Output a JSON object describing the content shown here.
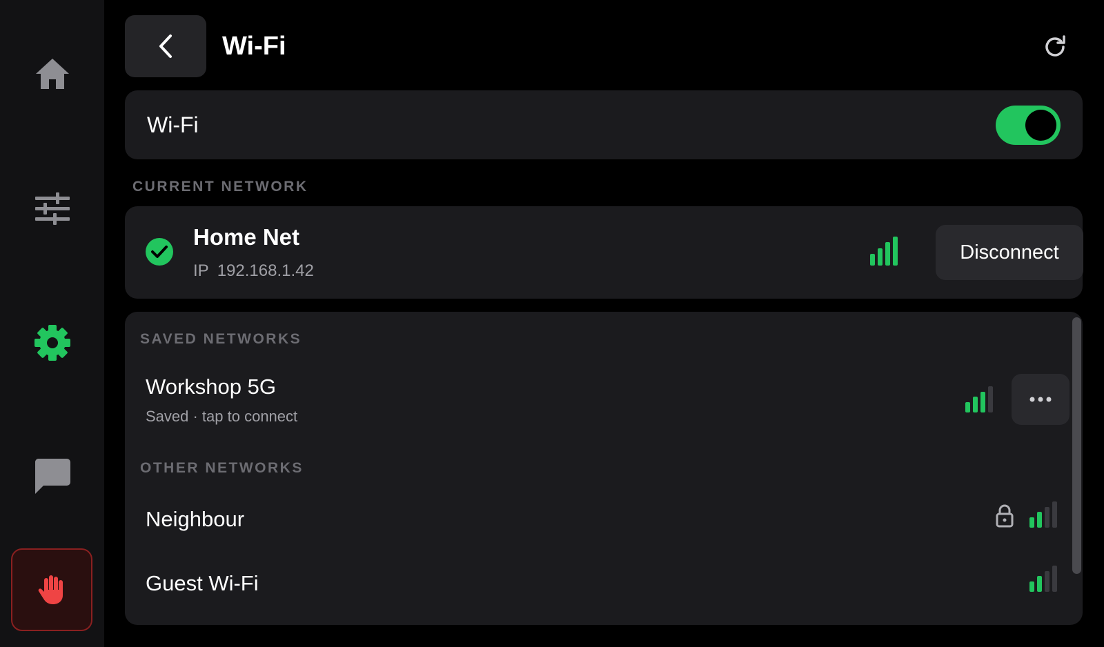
{
  "header": {
    "title": "Wi-Fi"
  },
  "wifi_toggle": {
    "label": "Wi-Fi",
    "enabled": true
  },
  "current_network": {
    "section_label": "CURRENT NETWORK",
    "name": "Home Net",
    "ip_label": "IP",
    "ip_address": "192.168.1.42",
    "signal_bars": 4,
    "disconnect_label": "Disconnect"
  },
  "saved_networks": {
    "section_label": "SAVED NETWORKS",
    "items": [
      {
        "name": "Workshop 5G",
        "status": "Saved · tap to connect",
        "signal_bars": 3
      }
    ]
  },
  "other_networks": {
    "section_label": "OTHER NETWORKS",
    "items": [
      {
        "name": "Neighbour",
        "secured": true,
        "signal_bars": 2
      },
      {
        "name": "Guest Wi-Fi",
        "secured": false,
        "signal_bars": 2
      }
    ]
  },
  "sidebar": {
    "items": [
      {
        "icon": "home-icon",
        "active": false
      },
      {
        "icon": "sliders-icon",
        "active": false
      },
      {
        "icon": "gear-icon",
        "active": true
      },
      {
        "icon": "chat-icon",
        "active": false
      }
    ],
    "stop_icon": "hand-stop-icon"
  },
  "colors": {
    "accent": "#22c55e",
    "danger": "#ef4444",
    "signal_inactive": "#3a3a3f"
  }
}
